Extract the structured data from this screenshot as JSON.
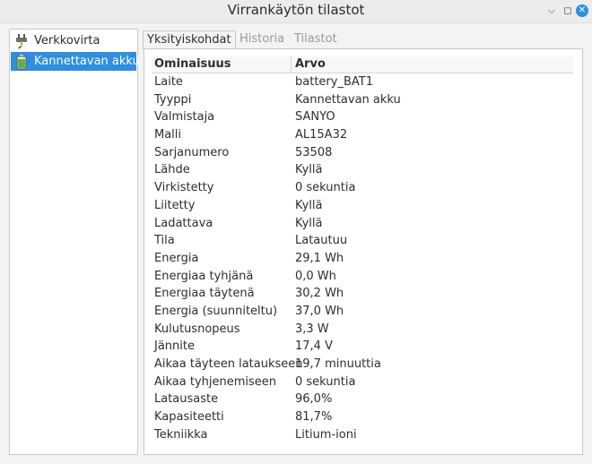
{
  "window": {
    "title": "Virrankäytön tilastot"
  },
  "sidebar": {
    "items": [
      {
        "label": "Verkkovirta",
        "icon": "power-plug-icon",
        "selected": false
      },
      {
        "label": "Kannettavan akku",
        "icon": "battery-icon",
        "selected": true
      }
    ]
  },
  "tabs": [
    {
      "label": "Yksityiskohdat",
      "active": true
    },
    {
      "label": "Historia",
      "active": false
    },
    {
      "label": "Tilastot",
      "active": false
    }
  ],
  "table": {
    "headers": [
      "Ominaisuus",
      "Arvo"
    ],
    "rows": [
      [
        "Laite",
        "battery_BAT1"
      ],
      [
        "Tyyppi",
        "Kannettavan akku"
      ],
      [
        "Valmistaja",
        "SANYO"
      ],
      [
        "Malli",
        "AL15A32"
      ],
      [
        "Sarjanumero",
        "53508"
      ],
      [
        "Lähde",
        "Kyllä"
      ],
      [
        "Virkistetty",
        "0 sekuntia"
      ],
      [
        "Liitetty",
        "Kyllä"
      ],
      [
        "Ladattava",
        "Kyllä"
      ],
      [
        "Tila",
        "Latautuu"
      ],
      [
        "Energia",
        "29,1 Wh"
      ],
      [
        "Energiaa tyhjänä",
        "0,0 Wh"
      ],
      [
        "Energiaa täytenä",
        "30,2 Wh"
      ],
      [
        "Energia (suunniteltu)",
        "37,0 Wh"
      ],
      [
        "Kulutusnopeus",
        "3,3 W"
      ],
      [
        "Jännite",
        "17,4 V"
      ],
      [
        "Aikaa täyteen lataukseen",
        "19,7 minuuttia"
      ],
      [
        "Aikaa tyhjenemiseen",
        "0 sekuntia"
      ],
      [
        "Latausaste",
        "96,0%"
      ],
      [
        "Kapasiteetti",
        "81,7%"
      ],
      [
        "Tekniikka",
        "Litium-ioni"
      ]
    ]
  },
  "colors": {
    "accent": "#2f8ee0"
  }
}
